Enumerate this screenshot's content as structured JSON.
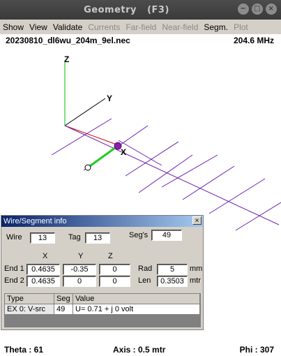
{
  "window": {
    "title": "Geometry",
    "shortcut": "(F3)",
    "buttons": [
      "−",
      "□",
      "×"
    ]
  },
  "menu": [
    {
      "label": "Show",
      "enabled": true
    },
    {
      "label": "View",
      "enabled": true
    },
    {
      "label": "Validate",
      "enabled": true
    },
    {
      "label": "Currents",
      "enabled": false
    },
    {
      "label": "Far-field",
      "enabled": false
    },
    {
      "label": "Near-field",
      "enabled": false
    },
    {
      "label": "Segm.",
      "enabled": true
    },
    {
      "label": "Plot",
      "enabled": false
    }
  ],
  "info": {
    "filename": "20230810_dl6wu_204m_9el.nec",
    "frequency": "204.6 MHz"
  },
  "axes": {
    "x_label": "X",
    "y_label": "Y",
    "z_label": "Z",
    "colors": {
      "x": "#cc0000",
      "y": "#000000",
      "z": "#00c000",
      "wires": "#6a1fb0",
      "selected": "#22cc22"
    }
  },
  "dialog": {
    "title": "Wire/Segment info",
    "close": "×",
    "wire_label": "Wire",
    "wire_value": "13",
    "tag_label": "Tag",
    "tag_value": "13",
    "segs_label": "Seg's",
    "segs_value": "49",
    "col_x": "X",
    "col_y": "Y",
    "col_z": "Z",
    "end1_label": "End 1",
    "end1_x": "0.4635",
    "end1_y": "-0.35",
    "end1_z": "0",
    "end2_label": "End 2",
    "end2_x": "0.4635",
    "end2_y": "0",
    "end2_z": "0",
    "rad_label": "Rad",
    "rad_value": "5",
    "rad_unit": "mm",
    "len_label": "Len",
    "len_value": "0.3503",
    "len_unit": "mtr",
    "table": {
      "headers": [
        "Type",
        "Seg",
        "Value"
      ],
      "rows": [
        [
          "EX 0: V-src",
          "49",
          "U= 0.71 + j 0 volt"
        ]
      ]
    }
  },
  "status": {
    "theta": "Theta : 61",
    "axis": "Axis : 0.5 mtr",
    "phi": "Phi : 307"
  }
}
